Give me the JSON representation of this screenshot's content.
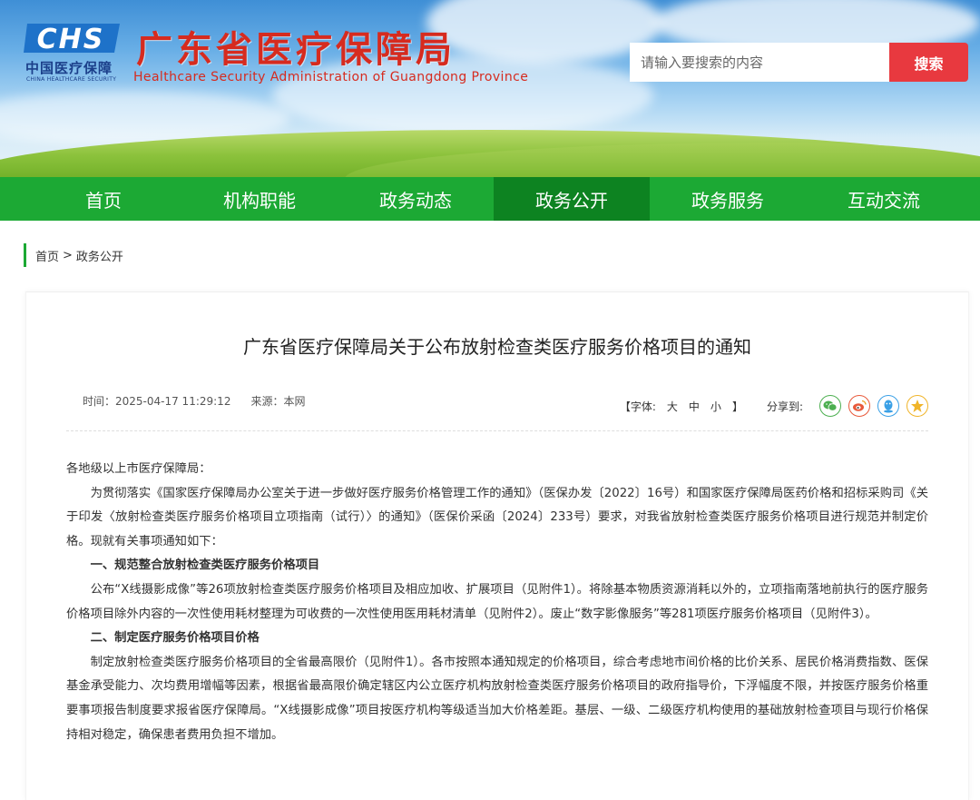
{
  "header": {
    "logo_text": "CHS",
    "logo_cn": "中国医疗保障",
    "logo_en": "CHINA HEALTHCARE SECURITY",
    "site_title": "广东省医疗保障局",
    "site_subtitle": "Healthcare Security Administration of Guangdong Province",
    "search_placeholder": "请输入要搜索的内容",
    "search_button": "搜索"
  },
  "nav": {
    "items": [
      {
        "label": "首页"
      },
      {
        "label": "机构职能"
      },
      {
        "label": "政务动态"
      },
      {
        "label": "政务公开",
        "active": true
      },
      {
        "label": "政务服务"
      },
      {
        "label": "互动交流"
      }
    ]
  },
  "breadcrumb": {
    "home": "首页",
    "separator": ">",
    "current": "政务公开"
  },
  "article": {
    "title": "广东省医疗保障局关于公布放射检查类医疗服务价格项目的通知",
    "time": "时间：2025-04-17 11:29:12",
    "source": "来源：本网",
    "font_label_open": "【字体:",
    "font_large": "大",
    "font_medium": "中",
    "font_small": "小",
    "font_label_close": "】",
    "share_label": "分享到:",
    "share_icons": [
      "wechat-icon",
      "weibo-icon",
      "qq-icon",
      "qzone-icon"
    ],
    "paragraphs": [
      {
        "type": "plain",
        "text": "各地级以上市医疗保障局："
      },
      {
        "type": "indent",
        "text": "为贯彻落实《国家医疗保障局办公室关于进一步做好医疗服务价格管理工作的通知》（医保办发〔2022〕16号）和国家医疗保障局医药价格和招标采购司《关于印发〈放射检查类医疗服务价格项目立项指南（试行）〉的通知》（医保价采函〔2024〕233号）要求，对我省放射检查类医疗服务价格项目进行规范并制定价格。现就有关事项通知如下："
      },
      {
        "type": "heading",
        "text": "一、规范整合放射检查类医疗服务价格项目"
      },
      {
        "type": "indent",
        "text": "公布“X线摄影成像”等26项放射检查类医疗服务价格项目及相应加收、扩展项目（见附件1）。将除基本物质资源消耗以外的，立项指南落地前执行的医疗服务价格项目除外内容的一次性使用耗材整理为可收费的一次性使用医用耗材清单（见附件2）。废止“数字影像服务”等281项医疗服务价格项目（见附件3）。"
      },
      {
        "type": "heading",
        "text": "二、制定医疗服务价格项目价格"
      },
      {
        "type": "indent",
        "text": "制定放射检查类医疗服务价格项目的全省最高限价（见附件1）。各市按照本通知规定的价格项目，综合考虑地市间价格的比价关系、居民价格消费指数、医保基金承受能力、次均费用增幅等因素，根据省最高限价确定辖区内公立医疗机构放射检查类医疗服务价格项目的政府指导价，下浮幅度不限，并按医疗服务价格重要事项报告制度要求报省医疗保障局。“X线摄影成像”项目按医疗机构等级适当加大价格差距。基层、一级、二级医疗机构使用的基础放射检查项目与现行价格保持相对稳定，确保患者费用负担不增加。"
      }
    ]
  },
  "colors": {
    "nav_green": "#1ca934",
    "nav_active": "#0d8321",
    "title_red": "#d62b1f",
    "search_red": "#e8393f",
    "logo_blue": "#1b3f8a"
  }
}
